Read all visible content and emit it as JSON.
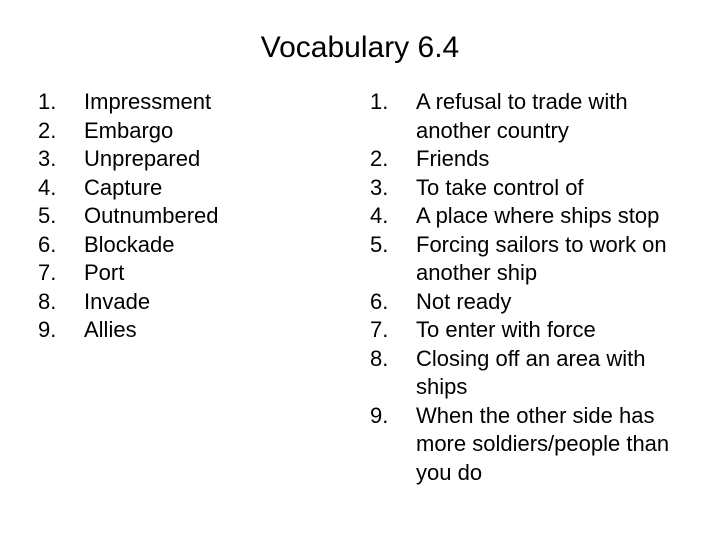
{
  "slide": {
    "title": "Vocabulary 6.4",
    "background_color": "#ffffff",
    "text_color": "#000000"
  },
  "terms": {
    "heading": "",
    "items": [
      {
        "number": "1.",
        "text": "Impressment"
      },
      {
        "number": "2.",
        "text": "Embargo"
      },
      {
        "number": "3.",
        "text": "Unprepared"
      },
      {
        "number": "4.",
        "text": "Capture"
      },
      {
        "number": "5.",
        "text": "Outnumbered"
      },
      {
        "number": "6.",
        "text": "Blockade"
      },
      {
        "number": "7.",
        "text": "Port"
      },
      {
        "number": "8.",
        "text": "Invade"
      },
      {
        "number": "9.",
        "text": "Allies"
      }
    ]
  },
  "definitions": {
    "heading": "",
    "items": [
      {
        "number": "1.",
        "text": "A refusal to trade with another country"
      },
      {
        "number": "2.",
        "text": "Friends"
      },
      {
        "number": "3.",
        "text": "To take control of"
      },
      {
        "number": "4.",
        "text": "A place where ships stop"
      },
      {
        "number": "5.",
        "text": "Forcing sailors to work on another ship"
      },
      {
        "number": "6.",
        "text": "Not ready"
      },
      {
        "number": "7.",
        "text": "To enter with force"
      },
      {
        "number": "8.",
        "text": "Closing off an area with ships"
      },
      {
        "number": "9.",
        "text": "When the other side has more soldiers/people than you do"
      }
    ]
  }
}
